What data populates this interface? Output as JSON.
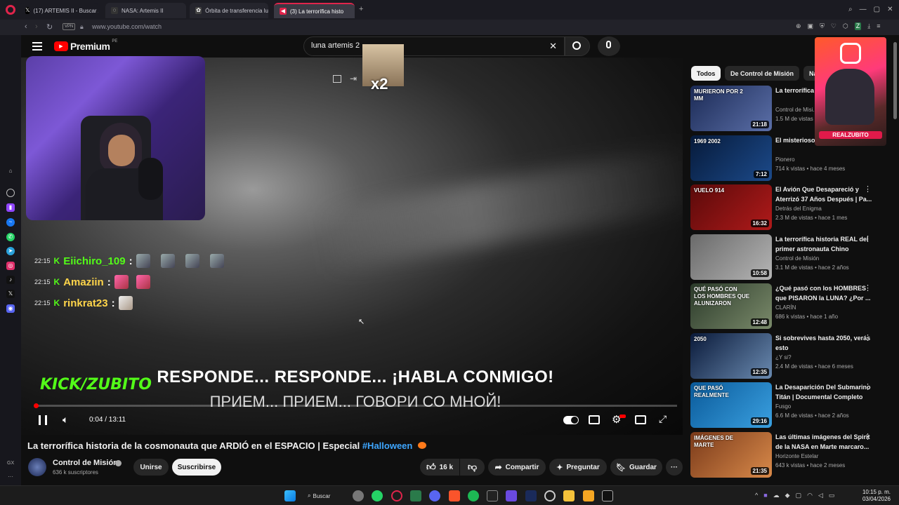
{
  "browser": {
    "tabs": [
      {
        "label": "(17) ARTEMIS II - Buscar /",
        "icon": "x-logo-icon"
      },
      {
        "label": "NASA: Artemis II",
        "icon": "nasa-icon"
      },
      {
        "label": "Órbita de transferencia lu",
        "icon": "chatgpt-icon"
      },
      {
        "label": "(3) La terrorífica histo",
        "icon": "youtube-icon"
      }
    ],
    "new_tab": "+",
    "vpn_label": "VPN",
    "url": "www.youtube.com/watch"
  },
  "masthead": {
    "logo": "Premium",
    "logo_country": "PE",
    "search_value": "luna artemis 2",
    "clear_glyph": "✕"
  },
  "stream_overlay": {
    "multiplier": "x2",
    "kick_brand": "KICK/ZUBITO",
    "insta_handle": "REALZUBITO",
    "chat": [
      {
        "time": "22:15",
        "user": "Eiichiro_109",
        "color": "#53fc18",
        "emotes": 4
      },
      {
        "time": "22:15",
        "user": "Amaziin",
        "color": "#ffd54a",
        "emotes": 2
      },
      {
        "time": "22:15",
        "user": "rinkrat23",
        "color": "#ffd54a",
        "emotes": 1
      }
    ],
    "separator": ":"
  },
  "video": {
    "subtitle_es": "RESPONDE... RESPONDE... ¡HABLA CONMIGO!",
    "subtitle_ru": "ПРИЕМ... ПРИЕМ... ГОВОРИ СО МНОЙ!",
    "time_current": "0:04 / 13:11",
    "progress": 0.005
  },
  "meta": {
    "title_main": "La terrorífica historia de la cosmonauta que ARDIÓ en el ESPACIO | Especial ",
    "title_hashtag": "#Halloween",
    "channel": "Control de Misión",
    "subscribers": "636 k suscriptores",
    "join_label": "Unirse",
    "subscribe_label": "Suscribirse",
    "likes": "16 k",
    "share_label": "Compartir",
    "ask_label": "Preguntar",
    "save_label": "Guardar"
  },
  "chips": [
    {
      "label": "Todos",
      "active": true
    },
    {
      "label": "De Control de Misión",
      "active": false
    },
    {
      "label": "Na",
      "active": false
    }
  ],
  "recommendations": [
    {
      "title": "La terrorífica ... las únicas pe...",
      "channel": "Control de Misi...",
      "meta": "1.5 M de vistas",
      "duration": "21:18",
      "thumb_text": "MURIERON POR 2 MM",
      "colors": [
        "#1b2a55",
        "#5b6fa8"
      ]
    },
    {
      "title": "El misterioso ... del Apolo 12",
      "channel": "Pionero",
      "meta": "714 k vistas • hace 4 meses",
      "duration": "7:12",
      "thumb_text": "1969  2002",
      "colors": [
        "#061a3a",
        "#1c4a8a"
      ]
    },
    {
      "title": "El Avión Que Desapareció y Aterrizó 37 Años Después | Pa...",
      "channel": "Detrás del Enigma",
      "meta": "2.3 M de vistas • hace 1 mes",
      "duration": "16:32",
      "thumb_text": "VUELO 914",
      "colors": [
        "#5a0a0a",
        "#b01a1a"
      ]
    },
    {
      "title": "La terrorífica historia REAL del primer astronauta Chino",
      "channel": "Control de Misión",
      "meta": "3.1 M de vistas • hace 2 años",
      "duration": "10:58",
      "thumb_text": "",
      "colors": [
        "#6a6a6a",
        "#b5b5b5"
      ]
    },
    {
      "title": "¿Qué pasó con los HOMBRES que PISARON la LUNA? ¿Por ...",
      "channel": "CLARÍN",
      "meta": "686 k vistas • hace 1 año",
      "duration": "12:48",
      "thumb_text": "QUÉ PASÓ CON LOS HOMBRES QUE ALUNIZARON",
      "colors": [
        "#2b3a2a",
        "#7a8a6a"
      ]
    },
    {
      "title": "Si sobrevives hasta 2050, verás esto",
      "channel": "¿Y si?",
      "meta": "2.4 M de vistas • hace 6 meses",
      "duration": "12:35",
      "thumb_text": "2050",
      "colors": [
        "#0a1a3a",
        "#6a8ab0"
      ]
    },
    {
      "title": "La Desaparición Del Submarino Titán | Documental Completo",
      "channel": "Fusgo",
      "meta": "6.6 M de vistas • hace 2 años",
      "duration": "29:16",
      "thumb_text": "QUE PASÓ REALMENTE",
      "colors": [
        "#0a5a9a",
        "#3aa0e0"
      ]
    },
    {
      "title": "Las últimas imágenes del Spirit de la NASA en Marte marcaro...",
      "channel": "Horizonte Estelar",
      "meta": "643 k vistas • hace 2 meses",
      "duration": "21:35",
      "thumb_text": "IMÁGENES DE MARTE",
      "colors": [
        "#7a3a1a",
        "#d98a4a"
      ]
    }
  ],
  "taskbar": {
    "search_label": "Buscar",
    "time": "10:15 p. m.",
    "date": "03/04/2026"
  },
  "sidebar_bottom": "GX"
}
